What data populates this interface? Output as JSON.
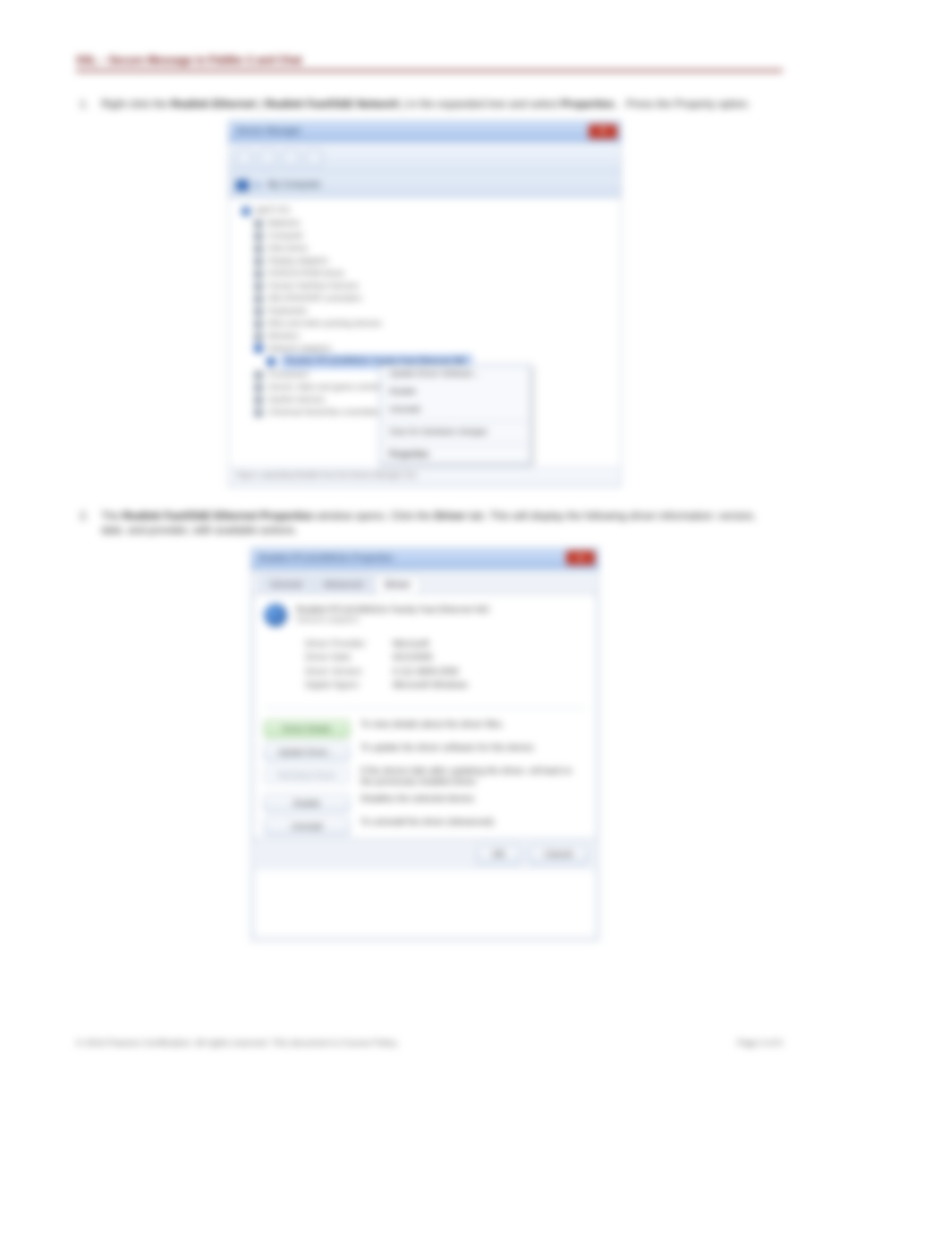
{
  "header": "SSL – Secure Message in Fiddler 2 and Chat",
  "step1": {
    "num": "1.",
    "text_a": "Right click the",
    "bold_a": "Realtek Ethernet",
    "text_b": "(",
    "bold_b": "Realtek Fast/GbE Network",
    "text_c": ") in the expanded tree and select",
    "bold_c": "Properties",
    "text_d": ". Press the Property option."
  },
  "step2": {
    "num": "2.",
    "text_a": "The",
    "bold_a": "Realtek Fast/GbE Ethernet Properties",
    "text_b": "window opens. Click the",
    "bold_b": "Driver",
    "text_c": "tab. This will display the following driver information: version, date, and provider, with available actions."
  },
  "shot1": {
    "title": "Device Manager",
    "addr_prefix": "▸",
    "addr": "My Computer",
    "tree": {
      "root": "MATT-PC",
      "items": [
        "Batteries",
        "Computer",
        "Disk drives",
        "Display adapters",
        "DVD/CD-ROM drives",
        "Human Interface Devices",
        "IDE ATA/ATAPI controllers",
        "Keyboards",
        "Mice and other pointing devices",
        "Monitors"
      ],
      "net_label": "Network adapters",
      "net_children": [
        "Realtek RTL8139/810x Family Fast Ethernet NIC"
      ],
      "after": [
        "Processors",
        "Sound, video and game controllers",
        "System devices",
        "Universal Serial Bus controllers"
      ],
      "highlight": "Realtek RTL8139/810x Family Fast Ethernet NIC"
    },
    "context_menu": [
      "Update Driver Software…",
      "Disable",
      "Uninstall",
      "Scan for hardware changes",
      "Properties"
    ],
    "caption": "Figure: expanding Realtek from the Device Manager tree."
  },
  "shot2": {
    "title": "Realtek RTL8139/810x Properties",
    "tabs": [
      "General",
      "Advanced",
      "Driver"
    ],
    "active_tab": 2,
    "dev_name": "Realtek RTL8139/810x Family Fast Ethernet NIC",
    "dev_sub": "Network adapters",
    "props": [
      {
        "label": "Driver Provider:",
        "value": "Microsoft"
      },
      {
        "label": "Driver Date:",
        "value": "6/21/2006"
      },
      {
        "label": "Driver Version:",
        "value": "6.111.0809.2006"
      },
      {
        "label": "Digital Signer:",
        "value": "Microsoft Windows"
      }
    ],
    "buttons": [
      {
        "label": "Driver Details",
        "desc": "To view details about the driver files.",
        "style": "green"
      },
      {
        "label": "Update Driver…",
        "desc": "To update the driver software for this device.",
        "style": ""
      },
      {
        "label": "Roll Back Driver",
        "desc": "If the device fails after updating the driver, roll back to the previously installed driver.",
        "style": "dis"
      },
      {
        "label": "Disable",
        "desc": "Disables the selected device.",
        "style": ""
      },
      {
        "label": "Uninstall",
        "desc": "To uninstall the driver (Advanced).",
        "style": ""
      }
    ],
    "ok": "OK",
    "cancel": "Cancel"
  },
  "footer": {
    "left": "© 2016 Pearson Certification. All rights reserved. This document is Course Policy.",
    "right": "Page 3 of 5"
  }
}
